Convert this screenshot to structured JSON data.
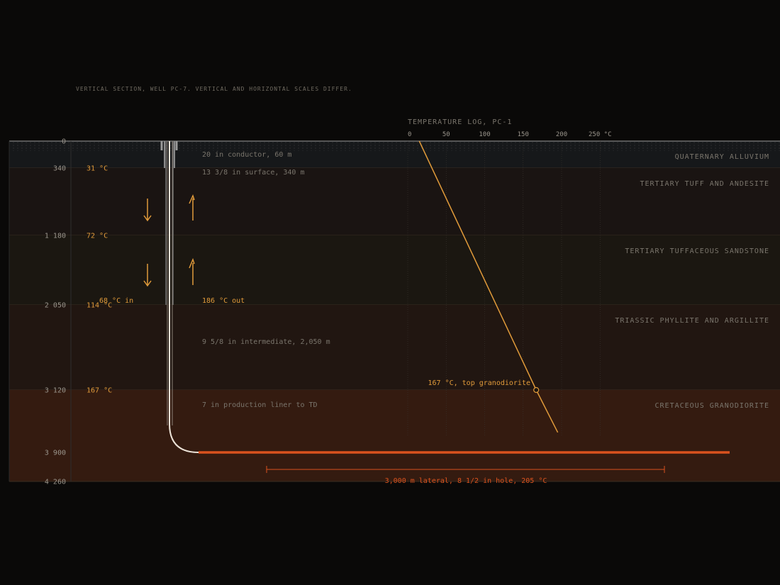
{
  "caption": "VERTICAL SECTION, WELL PC-7. VERTICAL AND HORIZONTAL SCALES DIFFER.",
  "depth_axis": {
    "ticks": [
      {
        "depth": 0,
        "label": "0"
      },
      {
        "depth": 340,
        "label": "340"
      },
      {
        "depth": 1180,
        "label": "1 180"
      },
      {
        "depth": 2050,
        "label": "2 050"
      },
      {
        "depth": 3120,
        "label": "3 120"
      },
      {
        "depth": 3900,
        "label": "3 900"
      },
      {
        "depth": 4260,
        "label": "4 260"
      }
    ]
  },
  "layers": [
    {
      "name": "QUATERNARY ALLUVIUM",
      "top": 0,
      "bottom": 340,
      "color": "#16181a"
    },
    {
      "name": "TERTIARY TUFF AND ANDESITE",
      "top": 340,
      "bottom": 1180,
      "color": "#1a1412"
    },
    {
      "name": "TERTIARY TUFFACEOUS SANDSTONE",
      "top": 1180,
      "bottom": 2050,
      "color": "#1b1711"
    },
    {
      "name": "TRIASSIC PHYLLITE AND ARGILLITE",
      "top": 2050,
      "bottom": 3120,
      "color": "#211611"
    },
    {
      "name": "CRETACEOUS GRANODIORITE",
      "top": 3120,
      "bottom": 4260,
      "color": "#341b10"
    }
  ],
  "temperatures": [
    {
      "depth": 340,
      "label": "31 °C"
    },
    {
      "depth": 1180,
      "label": "72 °C"
    },
    {
      "depth": 2050,
      "label": "114 °C"
    },
    {
      "depth": 3120,
      "label": "167 °C"
    }
  ],
  "casings": [
    {
      "label": "20 in conductor, 60 m"
    },
    {
      "label": "13 3/8 in surface, 340 m"
    },
    {
      "label": "9 5/8 in intermediate, 2,050 m"
    },
    {
      "label": "7 in production liner to TD"
    }
  ],
  "flow": {
    "in_label": "68 °C in",
    "out_label": "186 °C out"
  },
  "temp_log": {
    "title": "TEMPERATURE LOG, PC-1",
    "ticks": [
      "0",
      "50",
      "100",
      "150",
      "200",
      "250 °C"
    ],
    "annotation": "167 °C, top granodiorite"
  },
  "lateral": {
    "label": "3,000 m lateral, 8 1/2 in hole, 205 °C"
  },
  "colors": {
    "accent": "#e09a3a",
    "lateral": "#d9521e",
    "text_muted": "#7a756c"
  },
  "chart_data": {
    "type": "line",
    "title": "TEMPERATURE LOG, PC-1",
    "x_unit": "°C",
    "xlim": [
      0,
      250
    ],
    "y_unit": "m depth",
    "ylim": [
      4260,
      0
    ],
    "series": [
      {
        "points": [
          [
            15,
            0
          ],
          [
            167,
            3120
          ],
          [
            195,
            3650
          ]
        ]
      }
    ]
  }
}
